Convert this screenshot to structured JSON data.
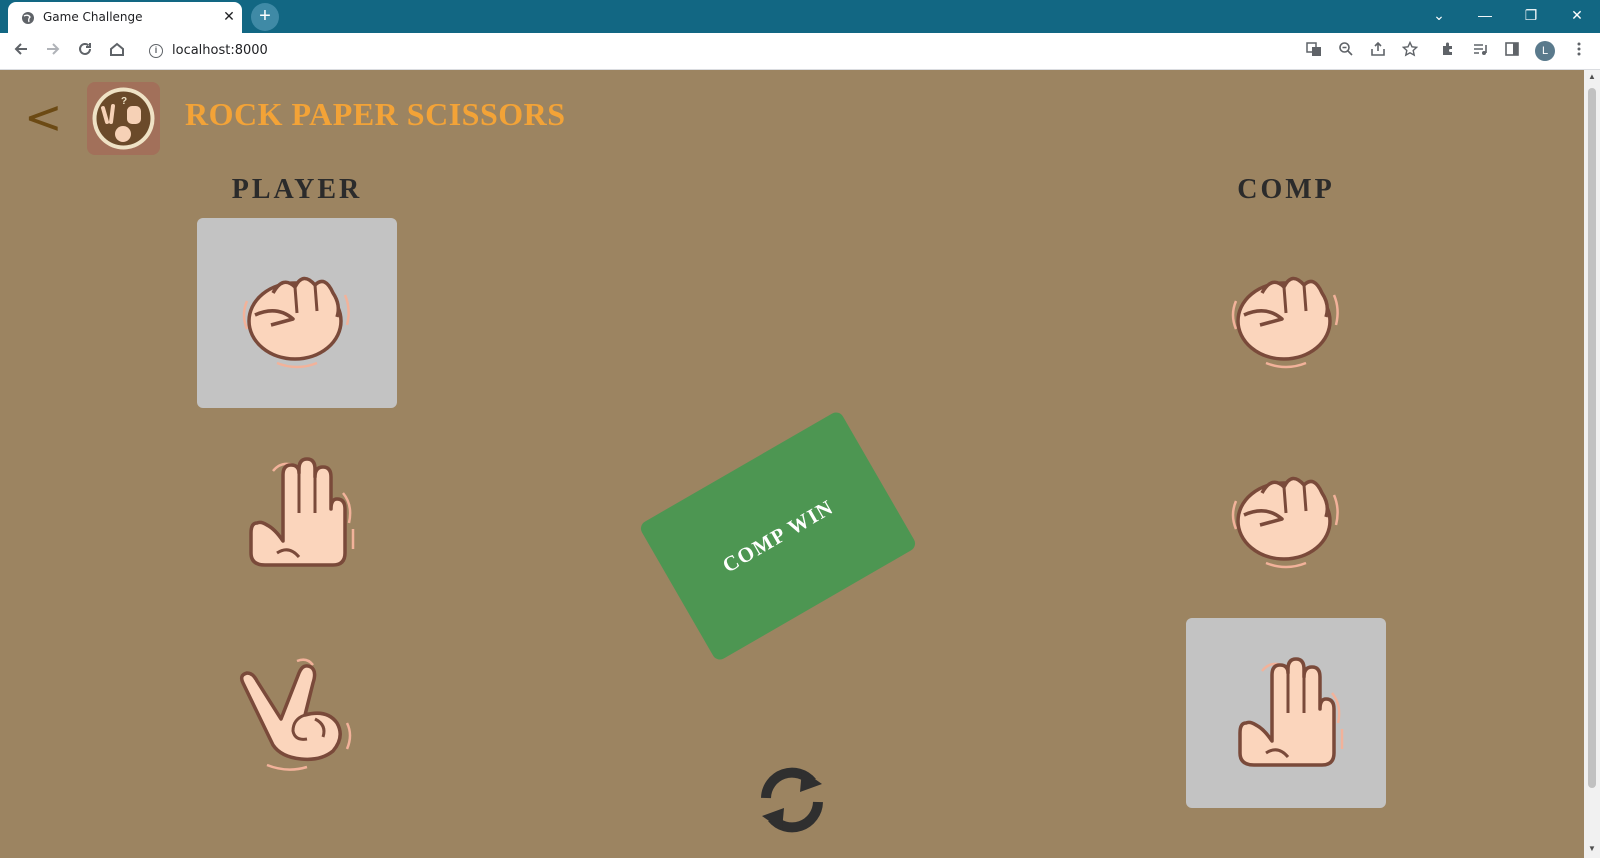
{
  "browser": {
    "tab_title": "Game Challenge",
    "tab_close": "✕",
    "new_tab": "+",
    "url": "localhost:8000",
    "avatar_letter": "L",
    "window_controls": {
      "dropdown": "⌄",
      "minimize": "—",
      "restore": "❐",
      "close": "✕"
    }
  },
  "header": {
    "back_label": "<",
    "title": "ROCK PAPER SCISSORS"
  },
  "player": {
    "heading": "PLAYER",
    "choices": [
      {
        "name": "rock",
        "selected": true
      },
      {
        "name": "paper",
        "selected": false
      },
      {
        "name": "scissors",
        "selected": false
      }
    ]
  },
  "comp": {
    "heading": "COMP",
    "choices": [
      {
        "name": "rock",
        "selected": false
      },
      {
        "name": "rock",
        "selected": false
      },
      {
        "name": "paper",
        "selected": true
      }
    ]
  },
  "result": {
    "text": "COMP WIN",
    "color": "#4d9652"
  },
  "colors": {
    "background": "#9c8461",
    "title": "#f3a337",
    "selected_tile": "#c3c3c3"
  },
  "icons": {
    "reset": "refresh-icon"
  }
}
